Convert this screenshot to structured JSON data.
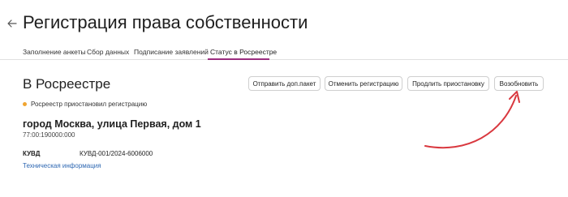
{
  "header": {
    "title": "Регистрация права собственности",
    "back_icon": "arrow-left-icon"
  },
  "tabs": [
    {
      "label": "Заполнение анкеты",
      "active": false
    },
    {
      "label": "Сбор данных",
      "active": false
    },
    {
      "label": "Подписание заявлений",
      "active": false
    },
    {
      "label": "Статус в Росреестре",
      "active": true
    }
  ],
  "section": {
    "title": "В Росреестре"
  },
  "actions": [
    {
      "label": "Отправить доп.пакет"
    },
    {
      "label": "Отменить регистрацию"
    },
    {
      "label": "Продлить приостановку"
    },
    {
      "label": "Возобновить"
    }
  ],
  "status": {
    "text": "Росреестр приостановил регистрацию",
    "color": "#f0a531"
  },
  "property": {
    "address": "город Москва, улица Первая, дом 1",
    "cadastral_number": "77:00:190000:000"
  },
  "kuvd": {
    "label": "КУВД",
    "value": "КУВД-001/2024-6006000"
  },
  "tech_info_link": "Техническая информация",
  "colors": {
    "accent_tab": "#9b2d7f",
    "link": "#2d67b2",
    "annotation_arrow": "#d9383f"
  }
}
